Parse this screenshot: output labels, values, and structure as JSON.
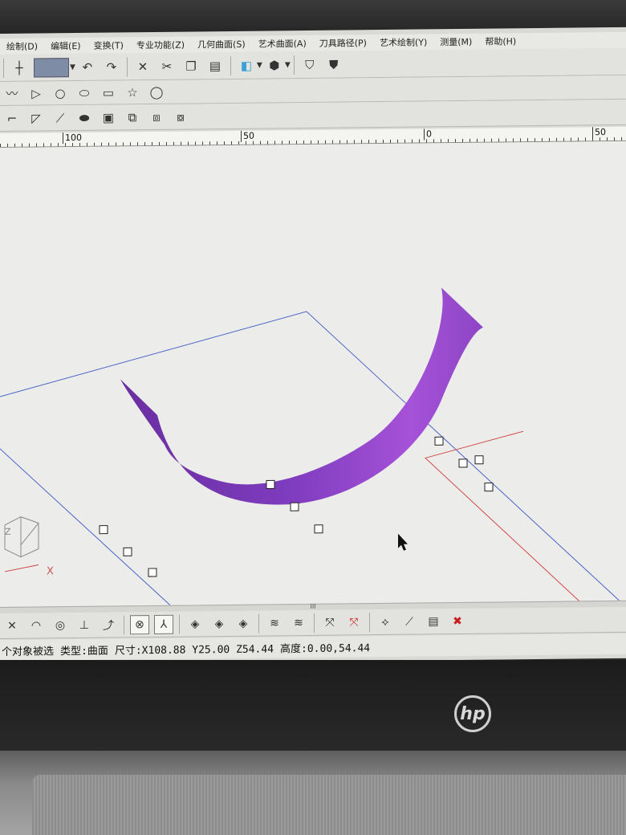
{
  "menubar": {
    "items": [
      "绘制(D)",
      "编辑(E)",
      "变换(T)",
      "专业功能(Z)",
      "几何曲面(S)",
      "艺术曲面(A)",
      "刀具路径(P)",
      "艺术绘制(Y)",
      "测量(M)",
      "帮助(H)"
    ]
  },
  "toolbar1": {
    "icons": [
      "line-icon",
      "select-box-icon",
      "undo-icon",
      "redo-icon",
      "delete-icon",
      "cut-icon",
      "copy-icon",
      "paste-icon",
      "cube-view-icon",
      "shade-icon",
      "shield-outline-icon",
      "shield-solid-icon"
    ]
  },
  "toolbar2": {
    "icons": [
      "polyline-icon",
      "triangle-icon",
      "circle-icon",
      "ellipse-icon",
      "rectangle-icon",
      "star-icon",
      "circle-large-icon"
    ]
  },
  "toolbar3": {
    "icons": [
      "corner-icon",
      "chamfer-icon",
      "trim-icon",
      "offset-icon",
      "frame-icon",
      "node-icon",
      "node-add-icon",
      "node-edit-icon"
    ]
  },
  "ruler": {
    "labels": [
      "100",
      "50",
      "0",
      "50"
    ]
  },
  "viewport": {
    "surface_color": "#9b4fd1",
    "frame_color_blue": "#4a64c8",
    "frame_color_red": "#d24a4a",
    "axis_x_label": "X",
    "axis_z_label": "Z"
  },
  "splitter": {
    "grip": "III"
  },
  "toolbar4": {
    "icons": [
      "snap-intersect-icon",
      "snap-arc-icon",
      "snap-circle-icon",
      "snap-perpendicular-icon",
      "snap-tangent-icon",
      "snap-point-icon",
      "snap-axis-icon",
      "view-top-icon",
      "view-front-icon",
      "view-side-icon",
      "layer-icon",
      "layer-add-icon",
      "select-icon",
      "deselect-icon",
      "path-icon",
      "path-edit-icon",
      "path-list-icon",
      "delete-icon"
    ]
  },
  "status": {
    "selection": "个对象被选",
    "type": "类型:曲面",
    "size": "尺寸:X108.88 Y25.00 Z54.44",
    "height": "高度:0.00,54.44"
  },
  "brand": {
    "logo_text": "hp"
  }
}
